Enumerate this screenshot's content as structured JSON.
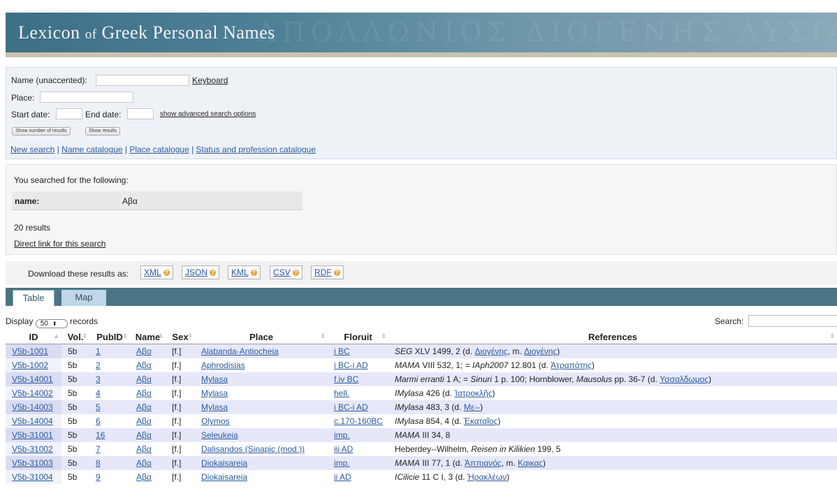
{
  "header": {
    "title_part1": "Lexicon",
    "title_of": "of",
    "title_part2": "Greek Personal Names",
    "bg_glyphs": "ΑΠΟΛΛΩΝΙΟΣ ΔΙΟΓΕΝΗΣ ΛΥΣΙΑΣ ΚΑΛΛΙΑΣ"
  },
  "search": {
    "name_label": "Name (unaccented):",
    "name_value": "",
    "keyboard_link": "Keyboard",
    "place_label": "Place:",
    "place_value": "",
    "start_label": "Start date:",
    "end_label": "End date:",
    "advanced_link": "show advanced search options",
    "btn_number": "Show number of results",
    "btn_results": "Show results",
    "nav": {
      "new_search": "New search",
      "name_catalogue": "Name catalogue",
      "place_catalogue": "Place catalogue",
      "status_catalogue": "Status and profession catalogue",
      "sep": " | "
    }
  },
  "summary": {
    "heading": "You searched for the following:",
    "criterion_key": "name:",
    "criterion_value": "Αβα",
    "count": "20 results",
    "direct_link": "Direct link for this search"
  },
  "download": {
    "label": "Download these results as:",
    "formats": [
      "XML",
      "JSON",
      "KML",
      "CSV",
      "RDF"
    ]
  },
  "tabs": [
    "Table",
    "Map"
  ],
  "table_controls": {
    "display_prefix": "Display",
    "display_value": "50",
    "display_suffix": "records",
    "search_label": "Search:"
  },
  "table": {
    "columns": [
      "ID",
      "Vol.",
      "PubID",
      "Name",
      "Sex",
      "Place",
      "Floruit",
      "References"
    ],
    "rows": [
      {
        "id": "V5b-1001",
        "vol": "5b",
        "pubid": "1",
        "name": "Αβα",
        "sex": "[f.]",
        "place": "Alabanda-Antiocheia",
        "floruit": "i BC",
        "ref": [
          {
            "t": "SEG",
            "i": true
          },
          {
            "t": " XLV 1499, 2 (d. "
          },
          {
            "t": "Διογένης",
            "a": true
          },
          {
            "t": ", m. "
          },
          {
            "t": "Διογένης",
            "a": true
          },
          {
            "t": ")"
          }
        ]
      },
      {
        "id": "V5b-1002",
        "vol": "5b",
        "pubid": "2",
        "name": "Αβα",
        "sex": "[f.]",
        "place": "Aphrodisias",
        "floruit": "i BC-i AD",
        "ref": [
          {
            "t": "MAMA",
            "i": true
          },
          {
            "t": " VIII 532, 1; = "
          },
          {
            "t": "IAph2007",
            "i": true
          },
          {
            "t": " 12.801 (d. "
          },
          {
            "t": "Ἀτραπάτης",
            "a": true
          },
          {
            "t": ")"
          }
        ]
      },
      {
        "id": "V5b-14001",
        "vol": "5b",
        "pubid": "3",
        "name": "Αβα",
        "sex": "[f.]",
        "place": "Mylasa",
        "floruit": "f.iv BC",
        "ref": [
          {
            "t": "Marmi erranti",
            "i": true
          },
          {
            "t": " 1 A; = "
          },
          {
            "t": "Sinuri",
            "i": true
          },
          {
            "t": " 1 p. 100; Hornblower, "
          },
          {
            "t": "Mausolus",
            "i": true
          },
          {
            "t": " pp. 36-7 (d. "
          },
          {
            "t": "Υσσαλδωμος",
            "a": true
          },
          {
            "t": ")"
          }
        ]
      },
      {
        "id": "V5b-14002",
        "vol": "5b",
        "pubid": "4",
        "name": "Αβα",
        "sex": "[f.]",
        "place": "Mylasa",
        "floruit": "hell.",
        "ref": [
          {
            "t": "IMylasa",
            "i": true
          },
          {
            "t": " 426 (d. "
          },
          {
            "t": "Ἰατροκλῆς",
            "a": true
          },
          {
            "t": ")"
          }
        ]
      },
      {
        "id": "V5b-14003",
        "vol": "5b",
        "pubid": "5",
        "name": "Αβα",
        "sex": "[f.]",
        "place": "Mylasa",
        "floruit": "i BC-i AD",
        "ref": [
          {
            "t": "IMylasa",
            "i": true
          },
          {
            "t": " 483, 3 (d. "
          },
          {
            "t": "Με--",
            "a": true
          },
          {
            "t": ")"
          }
        ]
      },
      {
        "id": "V5b-14004",
        "vol": "5b",
        "pubid": "6",
        "name": "Αβα",
        "sex": "[f.]",
        "place": "Olymos",
        "floruit": "c.170-160BC",
        "ref": [
          {
            "t": "IMylasa",
            "i": true
          },
          {
            "t": " 854, 4 (d. "
          },
          {
            "t": "Ἑκαταῖος",
            "a": true
          },
          {
            "t": ")"
          }
        ]
      },
      {
        "id": "V5b-31001",
        "vol": "5b",
        "pubid": "16",
        "name": "Αβα",
        "sex": "[f.]",
        "place": "Seleukeia",
        "floruit": "imp.",
        "ref": [
          {
            "t": "MAMA",
            "i": true
          },
          {
            "t": " III 34, 8"
          }
        ]
      },
      {
        "id": "V5b-31002",
        "vol": "5b",
        "pubid": "7",
        "name": "Αβα",
        "sex": "[f.]",
        "place": "Dalisandos (Sinapiç (mod.))",
        "floruit": "iii AD",
        "ref": [
          {
            "t": "Heberdey--Wilhelm, "
          },
          {
            "t": "Reisen in Kilikien",
            "i": true
          },
          {
            "t": " 199, 5"
          }
        ]
      },
      {
        "id": "V5b-31003",
        "vol": "5b",
        "pubid": "8",
        "name": "Αβα",
        "sex": "[f.]",
        "place": "Diokaisareia",
        "floruit": "imp.",
        "ref": [
          {
            "t": "MAMA",
            "i": true
          },
          {
            "t": " III 77, 1 (d. "
          },
          {
            "t": "Ἀππιανός",
            "a": true
          },
          {
            "t": ", m. "
          },
          {
            "t": "Καικας",
            "a": true
          },
          {
            "t": ")"
          }
        ]
      },
      {
        "id": "V5b-31004",
        "vol": "5b",
        "pubid": "9",
        "name": "Αβα",
        "sex": "[f.]",
        "place": "Diokaisareia",
        "floruit": "ii AD",
        "ref": [
          {
            "t": "ICilicie",
            "i": true
          },
          {
            "t": " 11 C I, 3 (d. "
          },
          {
            "t": "Ἡρακλέων",
            "a": true
          },
          {
            "t": ")"
          }
        ]
      }
    ]
  }
}
